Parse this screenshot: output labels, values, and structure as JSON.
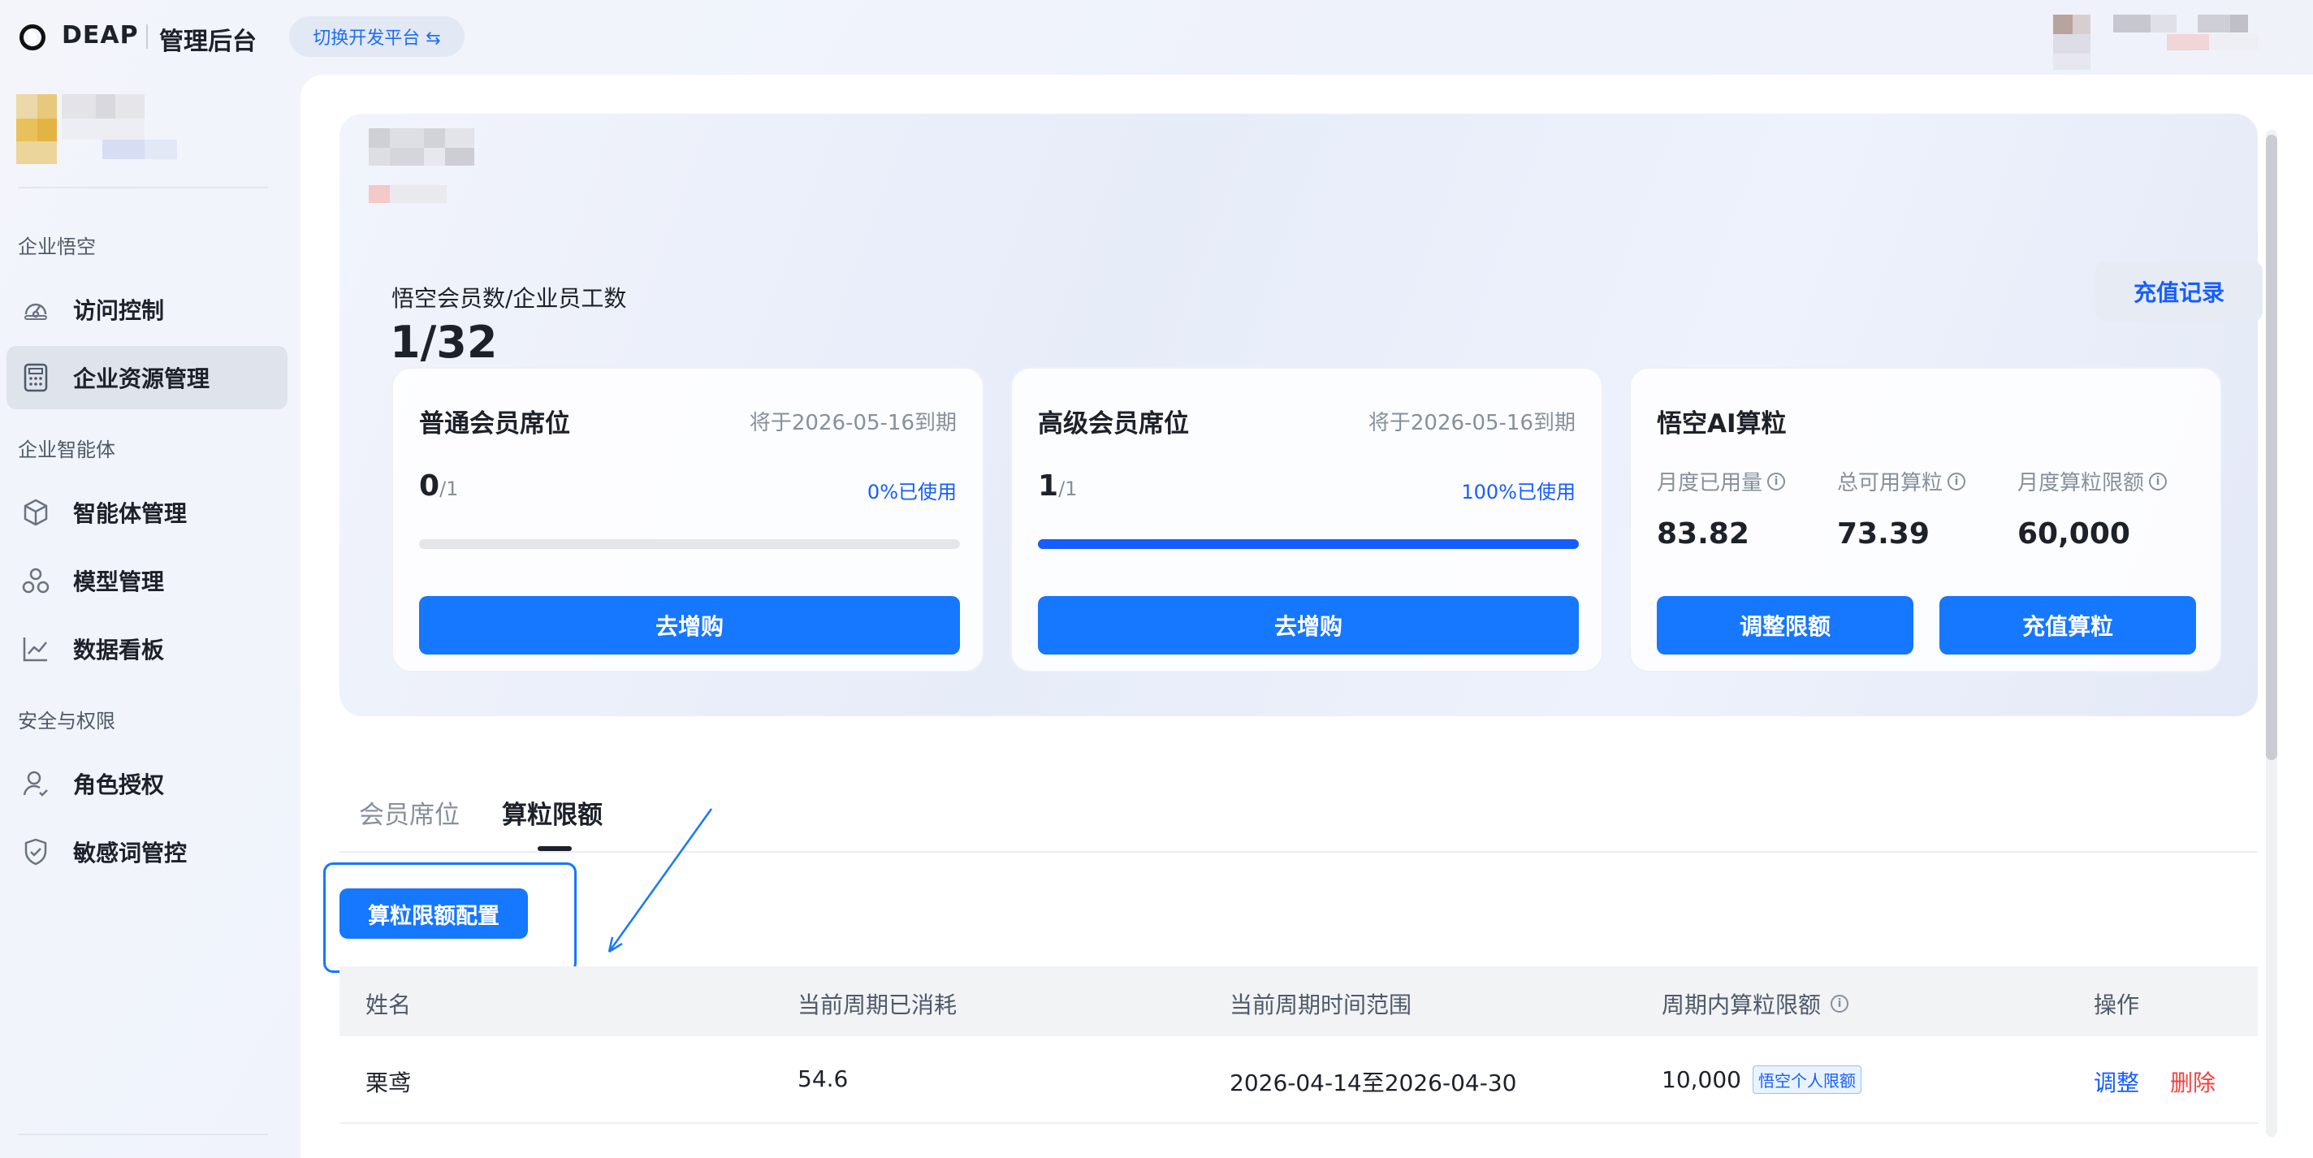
{
  "header": {
    "brand": "DEAP",
    "brand_sub": "管理后台",
    "switch_label": "切换开发平台 ⇆"
  },
  "sidebar": {
    "sections": [
      {
        "title": "企业悟空"
      },
      {
        "title": "企业智能体"
      },
      {
        "title": "安全与权限"
      }
    ],
    "items": [
      {
        "label": "访问控制",
        "icon": "gauge-icon"
      },
      {
        "label": "企业资源管理",
        "icon": "calculator-icon"
      },
      {
        "label": "智能体管理",
        "icon": "cube-icon"
      },
      {
        "label": "模型管理",
        "icon": "nodes-icon"
      },
      {
        "label": "数据看板",
        "icon": "line-chart-icon"
      },
      {
        "label": "角色授权",
        "icon": "user-icon"
      },
      {
        "label": "敏感词管控",
        "icon": "shield-icon"
      }
    ]
  },
  "hero": {
    "label": "悟空会员数/企业员工数",
    "value": "1/32",
    "recharge_record": "充值记录"
  },
  "cards": {
    "standard": {
      "title": "普通会员席位",
      "expire": "将于2026-05-16到期",
      "used": "0",
      "total": "/1",
      "used_label": "0%已使用",
      "progress": 0,
      "button": "去增购"
    },
    "premium": {
      "title": "高级会员席位",
      "expire": "将于2026-05-16到期",
      "used": "1",
      "total": "/1",
      "used_label": "100%已使用",
      "progress": 1,
      "button": "去增购"
    },
    "ai": {
      "title": "悟空AI算粒",
      "stats": [
        {
          "label": "月度已用量",
          "value": "83.82"
        },
        {
          "label": "总可用算粒",
          "value": "73.39"
        },
        {
          "label": "月度算粒限额",
          "value": "60,000"
        }
      ],
      "adjust_button": "调整限额",
      "recharge_button": "充值算粒"
    }
  },
  "tabs": [
    "会员席位",
    "算粒限额"
  ],
  "config_button": "算粒限额配置",
  "table": {
    "headers": [
      "姓名",
      "当前周期已消耗",
      "当前周期时间范围",
      "周期内算粒限额",
      "操作"
    ],
    "rows": [
      {
        "name": "栗鸢",
        "consumed": "54.6",
        "range": "2026-04-14至2026-04-30",
        "limit": "10,000",
        "tag": "悟空个人限额",
        "action_adjust": "调整",
        "action_delete": "删除"
      }
    ]
  },
  "colors": {
    "accent": "#1677ff",
    "danger": "#f53f3f"
  }
}
